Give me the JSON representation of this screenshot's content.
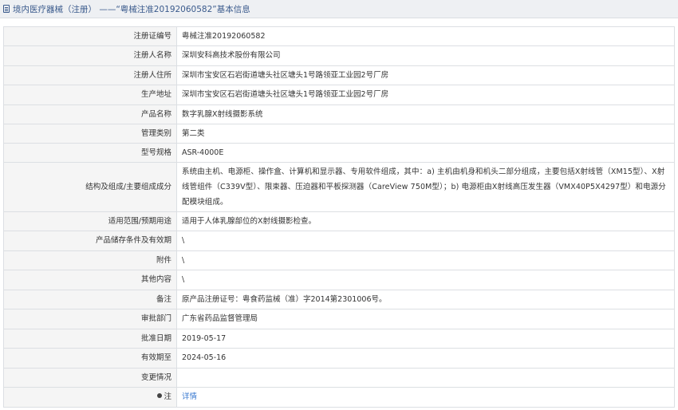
{
  "header": {
    "title": "境内医疗器械（注册）  ——“粤械注准20192060582”基本信息"
  },
  "rows": [
    {
      "label": "注册证编号",
      "value": "粤械注准20192060582"
    },
    {
      "label": "注册人名称",
      "value": "深圳安科高技术股份有限公司"
    },
    {
      "label": "注册人住所",
      "value": "深圳市宝安区石岩街道塘头社区塘头1号路领亚工业园2号厂房"
    },
    {
      "label": "生产地址",
      "value": "深圳市宝安区石岩街道塘头社区塘头1号路领亚工业园2号厂房"
    },
    {
      "label": "产品名称",
      "value": "数字乳腺X射线摄影系统"
    },
    {
      "label": "管理类别",
      "value": "第二类"
    },
    {
      "label": "型号规格",
      "value": "ASR-4000E"
    },
    {
      "label": "结构及组成/主要组成成分",
      "value": "系统由主机、电源柜、操作盒、计算机和显示器、专用软件组成，其中：a) 主机由机身和机头二部分组成，主要包括X射线管（XM15型）、X射线管组件（C339V型）、限束器、压迫器和平板探测器（CareView 750M型）；b) 电源柜由X射线高压发生器（VMX40P5X4297型）和电源分配模块组成。"
    },
    {
      "label": "适用范围/预期用途",
      "value": "适用于人体乳腺部位的X射线摄影检查。"
    },
    {
      "label": "产品储存条件及有效期",
      "value": "\\"
    },
    {
      "label": "附件",
      "value": "\\"
    },
    {
      "label": "其他内容",
      "value": "\\"
    },
    {
      "label": "备注",
      "value": "原产品注册证号：粤食药监械（准）字2014第2301006号。"
    },
    {
      "label": "审批部门",
      "value": "广东省药品监督管理局"
    },
    {
      "label": "批准日期",
      "value": "2019-05-17"
    },
    {
      "label": "有效期至",
      "value": "2024-05-16"
    },
    {
      "label": "变更情况",
      "value": ""
    },
    {
      "label": "注",
      "value": "详情"
    }
  ],
  "icons": {
    "header": "document-icon",
    "note": "pin-icon"
  },
  "colors": {
    "link": "#3a7ad0",
    "header_text": "#3a5a8c",
    "label_bg": "#f5f5f5",
    "border": "#dcdfe3"
  }
}
